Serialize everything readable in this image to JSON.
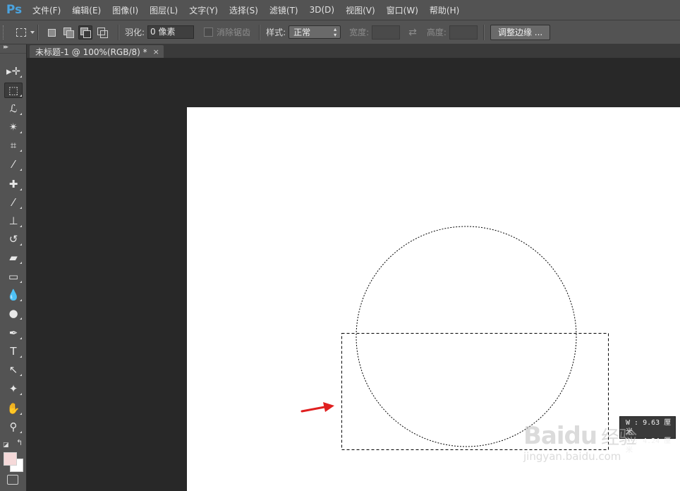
{
  "app": {
    "logo": "Ps",
    "accent_color": "#4aa3df"
  },
  "menu": [
    {
      "label": "文件(F)"
    },
    {
      "label": "编辑(E)"
    },
    {
      "label": "图像(I)"
    },
    {
      "label": "图层(L)"
    },
    {
      "label": "文字(Y)"
    },
    {
      "label": "选择(S)"
    },
    {
      "label": "滤镜(T)"
    },
    {
      "label": "3D(D)"
    },
    {
      "label": "视图(V)"
    },
    {
      "label": "窗口(W)"
    },
    {
      "label": "帮助(H)"
    }
  ],
  "options": {
    "feather_label": "羽化:",
    "feather_value": "0 像素",
    "antialias_label": "消除锯齿",
    "style_label": "样式:",
    "style_value": "正常",
    "width_label": "宽度:",
    "height_label": "高度:",
    "refine_edge_label": "调整边缘 ..."
  },
  "document": {
    "tab_title": "未标题-1 @ 100%(RGB/8) *",
    "close_glyph": "×",
    "canvas_color": "#ffffff"
  },
  "colors": {
    "foreground": "#f5d9d9",
    "background": "#ffffff"
  },
  "annotation": {
    "arrow_color": "#e02020"
  },
  "tooltip": {
    "width": "W : 9.63 厘米",
    "height": "H : 4.24 厘米"
  },
  "watermark": {
    "brand": "Baidu",
    "brand_suffix": "经验",
    "url": "jingyan.baidu.com"
  },
  "tools": [
    {
      "name": "move-tool-icon",
      "glyph": "▸✛"
    },
    {
      "name": "rect-marquee-tool-icon",
      "glyph": "⬚",
      "active": true
    },
    {
      "name": "lasso-tool-icon",
      "glyph": "ℒ"
    },
    {
      "name": "magic-wand-tool-icon",
      "glyph": "✴"
    },
    {
      "name": "crop-tool-icon",
      "glyph": "⌗"
    },
    {
      "name": "eyedropper-tool-icon",
      "glyph": "⁄"
    },
    {
      "name": "healing-brush-tool-icon",
      "glyph": "✚"
    },
    {
      "name": "brush-tool-icon",
      "glyph": "⁄"
    },
    {
      "name": "clone-stamp-tool-icon",
      "glyph": "⊥"
    },
    {
      "name": "history-brush-tool-icon",
      "glyph": "↺"
    },
    {
      "name": "eraser-tool-icon",
      "glyph": "▰"
    },
    {
      "name": "gradient-tool-icon",
      "glyph": "▭"
    },
    {
      "name": "blur-tool-icon",
      "glyph": "💧"
    },
    {
      "name": "dodge-tool-icon",
      "glyph": "●"
    },
    {
      "name": "pen-tool-icon",
      "glyph": "✒"
    },
    {
      "name": "type-tool-icon",
      "glyph": "T"
    },
    {
      "name": "path-select-tool-icon",
      "glyph": "↖"
    },
    {
      "name": "shape-tool-icon",
      "glyph": "✦"
    },
    {
      "name": "hand-tool-icon",
      "glyph": "✋"
    },
    {
      "name": "zoom-tool-icon",
      "glyph": "⚲"
    }
  ]
}
